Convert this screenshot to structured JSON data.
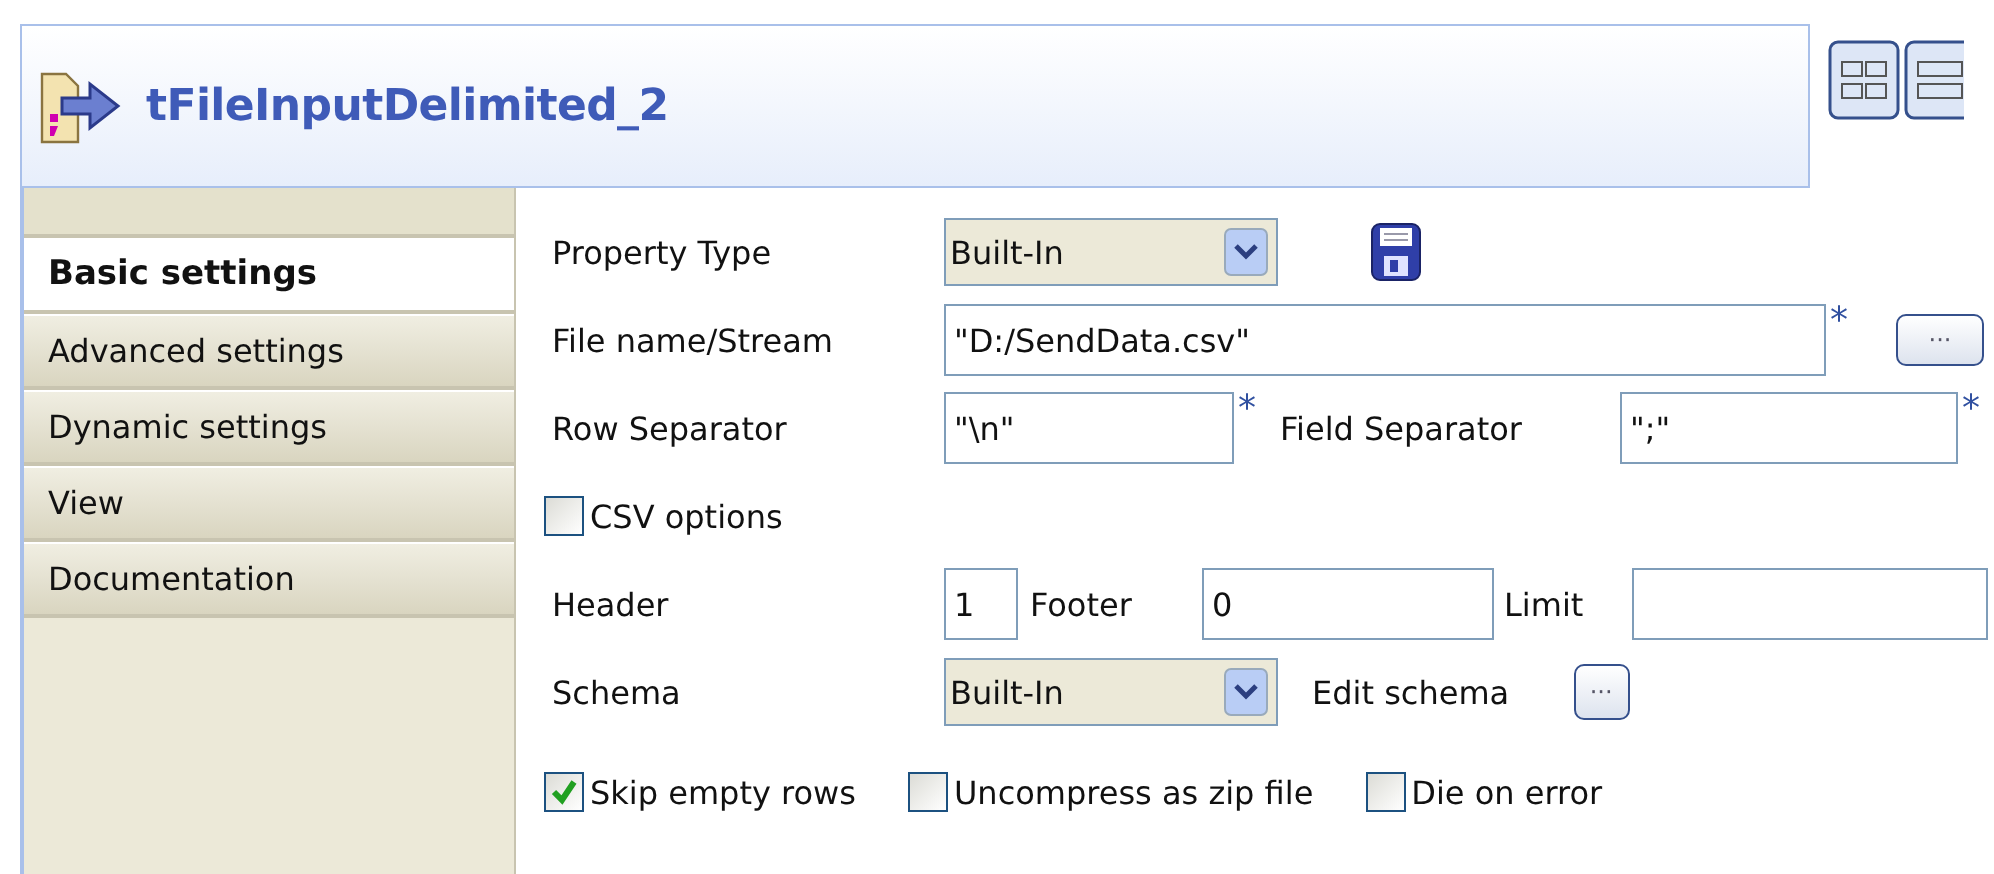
{
  "component": {
    "title": "tFileInputDelimited_2"
  },
  "tabs": [
    {
      "label": "Basic settings",
      "selected": true
    },
    {
      "label": "Advanced settings",
      "selected": false
    },
    {
      "label": "Dynamic settings",
      "selected": false
    },
    {
      "label": "View",
      "selected": false
    },
    {
      "label": "Documentation",
      "selected": false
    }
  ],
  "form": {
    "property_type": {
      "label": "Property Type",
      "value": "Built-In"
    },
    "file_name": {
      "label": "File name/Stream",
      "value": "\"D:/SendData.csv\"",
      "mark": "*",
      "button": "···"
    },
    "row_separator": {
      "label": "Row Separator",
      "value": "\"\\n\"",
      "mark": "*"
    },
    "field_separator": {
      "label": "Field Separator",
      "value": "\";\"",
      "mark": "*"
    },
    "csv_options": {
      "label": "CSV options",
      "checked": false
    },
    "header": {
      "label": "Header",
      "value": "1"
    },
    "footer": {
      "label": "Footer",
      "value": "0"
    },
    "limit": {
      "label": "Limit"
    },
    "schema": {
      "label": "Schema",
      "value": "Built-In"
    },
    "edit_schema": {
      "label": "Edit schema",
      "button": "···"
    },
    "options": [
      {
        "label": "Skip empty rows",
        "checked": true
      },
      {
        "label": "Uncompress as zip file",
        "checked": false
      },
      {
        "label": "Die on error",
        "checked": false
      }
    ]
  }
}
